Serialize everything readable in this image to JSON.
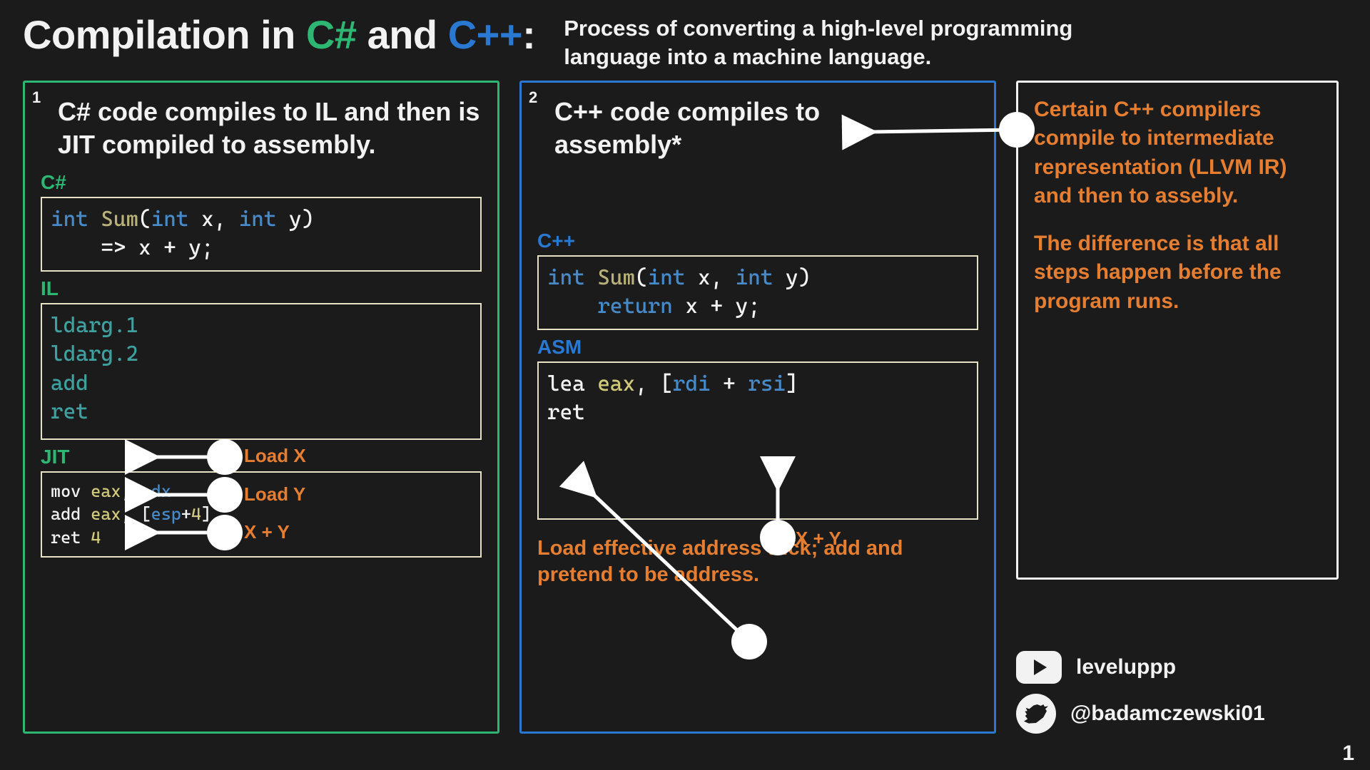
{
  "title": {
    "prefix": "Compilation in ",
    "csharp": "C#",
    "mid": " and ",
    "cpp": "C++",
    "suffix": ":"
  },
  "subtitle": "Process of converting a high-level programming language into a machine language.",
  "csharp_panel": {
    "number": "1",
    "heading": "C# code compiles to IL and then is JIT compiled to assembly.",
    "csharp_label": "C#",
    "csharp_code": {
      "tokens": [
        {
          "t": "int",
          "c": "kw"
        },
        {
          "t": " "
        },
        {
          "t": "Sum",
          "c": "fn"
        },
        {
          "t": "(",
          "c": "par"
        },
        {
          "t": "int",
          "c": "kw"
        },
        {
          "t": " x, ",
          "c": "par"
        },
        {
          "t": "int",
          "c": "kw"
        },
        {
          "t": " y",
          "c": "par"
        },
        {
          "t": ")",
          "c": "par"
        },
        {
          "t": "\n    => x + y;",
          "c": "par"
        }
      ]
    },
    "il_label": "IL",
    "il_code": [
      "ldarg.1",
      "ldarg.2",
      "add",
      "ret"
    ],
    "il_annotations": [
      "Load X",
      "Load Y",
      "X + Y"
    ],
    "jit_label": "JIT",
    "jit_code": {
      "tokens": [
        {
          "t": "mov",
          "c": "par"
        },
        {
          "t": " "
        },
        {
          "t": "eax",
          "c": "yt"
        },
        {
          "t": ", ",
          "c": "par"
        },
        {
          "t": "edx",
          "c": "kw"
        },
        {
          "t": "\n"
        },
        {
          "t": "add",
          "c": "par"
        },
        {
          "t": " "
        },
        {
          "t": "eax",
          "c": "yt"
        },
        {
          "t": ", [",
          "c": "par"
        },
        {
          "t": "esp",
          "c": "kw"
        },
        {
          "t": "+",
          "c": "par"
        },
        {
          "t": "4",
          "c": "yt"
        },
        {
          "t": "]\n",
          "c": "par"
        },
        {
          "t": "ret",
          "c": "par"
        },
        {
          "t": " "
        },
        {
          "t": "4",
          "c": "yt"
        }
      ]
    }
  },
  "cpp_panel": {
    "number": "2",
    "heading": "C++ code compiles to assembly*",
    "cpp_label": "C++",
    "cpp_code": {
      "tokens": [
        {
          "t": "int",
          "c": "kw"
        },
        {
          "t": " "
        },
        {
          "t": "Sum",
          "c": "fn"
        },
        {
          "t": "(",
          "c": "par"
        },
        {
          "t": "int",
          "c": "kw"
        },
        {
          "t": " x, ",
          "c": "par"
        },
        {
          "t": "int",
          "c": "kw"
        },
        {
          "t": " y",
          "c": "par"
        },
        {
          "t": ")",
          "c": "par"
        },
        {
          "t": "\n    ",
          "c": "par"
        },
        {
          "t": "return",
          "c": "kw"
        },
        {
          "t": " x + y;",
          "c": "par"
        }
      ]
    },
    "asm_label": "ASM",
    "asm_code": {
      "tokens": [
        {
          "t": "lea",
          "c": "par"
        },
        {
          "t": " "
        },
        {
          "t": "eax",
          "c": "yt"
        },
        {
          "t": ", [",
          "c": "par"
        },
        {
          "t": "rdi",
          "c": "kw"
        },
        {
          "t": " + ",
          "c": "par"
        },
        {
          "t": "rsi",
          "c": "kw"
        },
        {
          "t": "]\n",
          "c": "par"
        },
        {
          "t": "ret",
          "c": "par"
        }
      ]
    },
    "asm_annotation_xy": "X + Y",
    "note": "Load effective address trick; add and pretend to be address."
  },
  "side_panel": {
    "p1": "Certain C++ compilers compile to intermediate representation (LLVM IR) and then to assebly.",
    "p2": "The difference is that all steps happen before the program runs."
  },
  "socials": {
    "youtube": "leveluppp",
    "twitter": "@badamczewski01"
  },
  "page_number": "1",
  "colors": {
    "green": "#2eb673",
    "blue": "#2979d3",
    "orange": "#e67e32"
  }
}
